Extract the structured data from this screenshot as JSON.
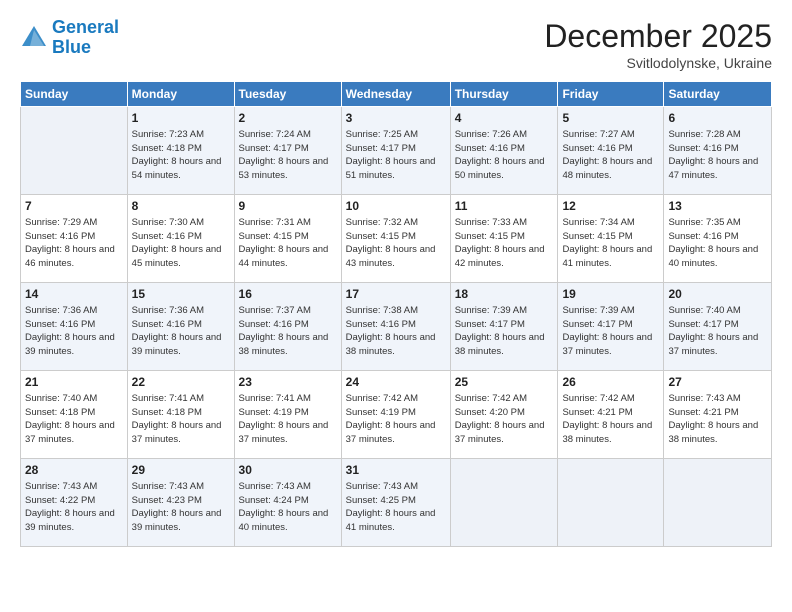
{
  "header": {
    "logo_line1": "General",
    "logo_line2": "Blue",
    "month_title": "December 2025",
    "subtitle": "Svitlodolynske, Ukraine"
  },
  "weekdays": [
    "Sunday",
    "Monday",
    "Tuesday",
    "Wednesday",
    "Thursday",
    "Friday",
    "Saturday"
  ],
  "weeks": [
    [
      {
        "day": "",
        "sunrise": "",
        "sunset": "",
        "daylight": ""
      },
      {
        "day": "1",
        "sunrise": "Sunrise: 7:23 AM",
        "sunset": "Sunset: 4:18 PM",
        "daylight": "Daylight: 8 hours and 54 minutes."
      },
      {
        "day": "2",
        "sunrise": "Sunrise: 7:24 AM",
        "sunset": "Sunset: 4:17 PM",
        "daylight": "Daylight: 8 hours and 53 minutes."
      },
      {
        "day": "3",
        "sunrise": "Sunrise: 7:25 AM",
        "sunset": "Sunset: 4:17 PM",
        "daylight": "Daylight: 8 hours and 51 minutes."
      },
      {
        "day": "4",
        "sunrise": "Sunrise: 7:26 AM",
        "sunset": "Sunset: 4:16 PM",
        "daylight": "Daylight: 8 hours and 50 minutes."
      },
      {
        "day": "5",
        "sunrise": "Sunrise: 7:27 AM",
        "sunset": "Sunset: 4:16 PM",
        "daylight": "Daylight: 8 hours and 48 minutes."
      },
      {
        "day": "6",
        "sunrise": "Sunrise: 7:28 AM",
        "sunset": "Sunset: 4:16 PM",
        "daylight": "Daylight: 8 hours and 47 minutes."
      }
    ],
    [
      {
        "day": "7",
        "sunrise": "Sunrise: 7:29 AM",
        "sunset": "Sunset: 4:16 PM",
        "daylight": "Daylight: 8 hours and 46 minutes."
      },
      {
        "day": "8",
        "sunrise": "Sunrise: 7:30 AM",
        "sunset": "Sunset: 4:16 PM",
        "daylight": "Daylight: 8 hours and 45 minutes."
      },
      {
        "day": "9",
        "sunrise": "Sunrise: 7:31 AM",
        "sunset": "Sunset: 4:15 PM",
        "daylight": "Daylight: 8 hours and 44 minutes."
      },
      {
        "day": "10",
        "sunrise": "Sunrise: 7:32 AM",
        "sunset": "Sunset: 4:15 PM",
        "daylight": "Daylight: 8 hours and 43 minutes."
      },
      {
        "day": "11",
        "sunrise": "Sunrise: 7:33 AM",
        "sunset": "Sunset: 4:15 PM",
        "daylight": "Daylight: 8 hours and 42 minutes."
      },
      {
        "day": "12",
        "sunrise": "Sunrise: 7:34 AM",
        "sunset": "Sunset: 4:15 PM",
        "daylight": "Daylight: 8 hours and 41 minutes."
      },
      {
        "day": "13",
        "sunrise": "Sunrise: 7:35 AM",
        "sunset": "Sunset: 4:16 PM",
        "daylight": "Daylight: 8 hours and 40 minutes."
      }
    ],
    [
      {
        "day": "14",
        "sunrise": "Sunrise: 7:36 AM",
        "sunset": "Sunset: 4:16 PM",
        "daylight": "Daylight: 8 hours and 39 minutes."
      },
      {
        "day": "15",
        "sunrise": "Sunrise: 7:36 AM",
        "sunset": "Sunset: 4:16 PM",
        "daylight": "Daylight: 8 hours and 39 minutes."
      },
      {
        "day": "16",
        "sunrise": "Sunrise: 7:37 AM",
        "sunset": "Sunset: 4:16 PM",
        "daylight": "Daylight: 8 hours and 38 minutes."
      },
      {
        "day": "17",
        "sunrise": "Sunrise: 7:38 AM",
        "sunset": "Sunset: 4:16 PM",
        "daylight": "Daylight: 8 hours and 38 minutes."
      },
      {
        "day": "18",
        "sunrise": "Sunrise: 7:39 AM",
        "sunset": "Sunset: 4:17 PM",
        "daylight": "Daylight: 8 hours and 38 minutes."
      },
      {
        "day": "19",
        "sunrise": "Sunrise: 7:39 AM",
        "sunset": "Sunset: 4:17 PM",
        "daylight": "Daylight: 8 hours and 37 minutes."
      },
      {
        "day": "20",
        "sunrise": "Sunrise: 7:40 AM",
        "sunset": "Sunset: 4:17 PM",
        "daylight": "Daylight: 8 hours and 37 minutes."
      }
    ],
    [
      {
        "day": "21",
        "sunrise": "Sunrise: 7:40 AM",
        "sunset": "Sunset: 4:18 PM",
        "daylight": "Daylight: 8 hours and 37 minutes."
      },
      {
        "day": "22",
        "sunrise": "Sunrise: 7:41 AM",
        "sunset": "Sunset: 4:18 PM",
        "daylight": "Daylight: 8 hours and 37 minutes."
      },
      {
        "day": "23",
        "sunrise": "Sunrise: 7:41 AM",
        "sunset": "Sunset: 4:19 PM",
        "daylight": "Daylight: 8 hours and 37 minutes."
      },
      {
        "day": "24",
        "sunrise": "Sunrise: 7:42 AM",
        "sunset": "Sunset: 4:19 PM",
        "daylight": "Daylight: 8 hours and 37 minutes."
      },
      {
        "day": "25",
        "sunrise": "Sunrise: 7:42 AM",
        "sunset": "Sunset: 4:20 PM",
        "daylight": "Daylight: 8 hours and 37 minutes."
      },
      {
        "day": "26",
        "sunrise": "Sunrise: 7:42 AM",
        "sunset": "Sunset: 4:21 PM",
        "daylight": "Daylight: 8 hours and 38 minutes."
      },
      {
        "day": "27",
        "sunrise": "Sunrise: 7:43 AM",
        "sunset": "Sunset: 4:21 PM",
        "daylight": "Daylight: 8 hours and 38 minutes."
      }
    ],
    [
      {
        "day": "28",
        "sunrise": "Sunrise: 7:43 AM",
        "sunset": "Sunset: 4:22 PM",
        "daylight": "Daylight: 8 hours and 39 minutes."
      },
      {
        "day": "29",
        "sunrise": "Sunrise: 7:43 AM",
        "sunset": "Sunset: 4:23 PM",
        "daylight": "Daylight: 8 hours and 39 minutes."
      },
      {
        "day": "30",
        "sunrise": "Sunrise: 7:43 AM",
        "sunset": "Sunset: 4:24 PM",
        "daylight": "Daylight: 8 hours and 40 minutes."
      },
      {
        "day": "31",
        "sunrise": "Sunrise: 7:43 AM",
        "sunset": "Sunset: 4:25 PM",
        "daylight": "Daylight: 8 hours and 41 minutes."
      },
      {
        "day": "",
        "sunrise": "",
        "sunset": "",
        "daylight": ""
      },
      {
        "day": "",
        "sunrise": "",
        "sunset": "",
        "daylight": ""
      },
      {
        "day": "",
        "sunrise": "",
        "sunset": "",
        "daylight": ""
      }
    ]
  ]
}
